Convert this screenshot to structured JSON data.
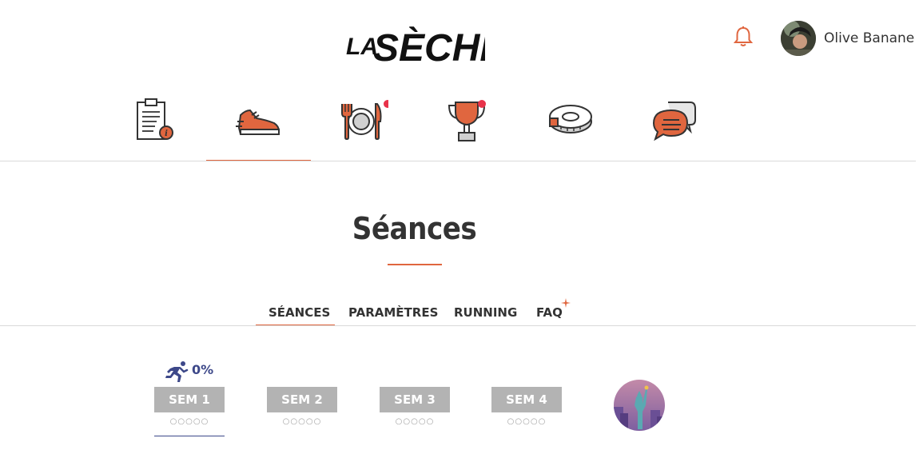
{
  "header": {
    "logo_text": "LASÈCHE",
    "user_name": "Olive Banane",
    "bell_icon": "bell-icon"
  },
  "nav": [
    {
      "icon": "clipboard-info-icon",
      "badge": false
    },
    {
      "icon": "running-shoe-icon",
      "badge": false,
      "active": true
    },
    {
      "icon": "plate-cutlery-icon",
      "badge": true
    },
    {
      "icon": "trophy-icon",
      "badge": true
    },
    {
      "icon": "measuring-tape-icon",
      "badge": false
    },
    {
      "icon": "chat-bubbles-icon",
      "badge": false
    }
  ],
  "page": {
    "title": "Séances"
  },
  "tabs": [
    {
      "label": "SÉANCES",
      "active": true
    },
    {
      "label": "PARAMÈTRES"
    },
    {
      "label": "RUNNING"
    },
    {
      "label": "FAQ",
      "marker": true
    }
  ],
  "weeks": {
    "progress": "0%",
    "items": [
      {
        "label": "SEM 1",
        "dots": "○○○○○"
      },
      {
        "label": "SEM 2",
        "dots": "○○○○○"
      },
      {
        "label": "SEM 3",
        "dots": "○○○○○"
      },
      {
        "label": "SEM 4",
        "dots": "○○○○○"
      }
    ],
    "reward_icon": "statue-of-liberty-icon"
  },
  "colors": {
    "accent": "#e0663f",
    "navy": "#3d4889",
    "week_bg": "#b3b3b3",
    "badge": "#e8334a"
  }
}
